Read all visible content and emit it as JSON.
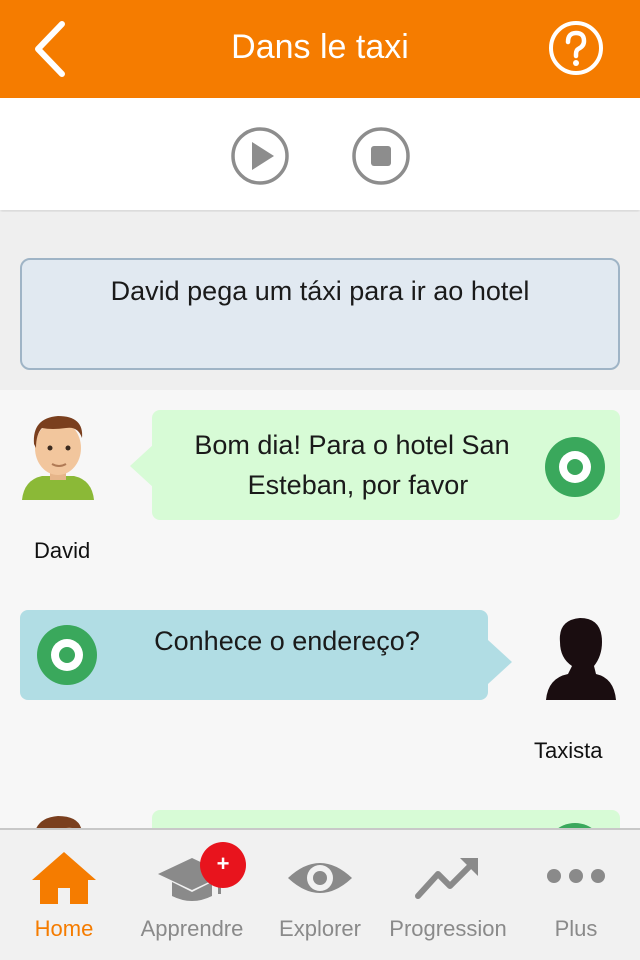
{
  "header": {
    "title": "Dans le taxi",
    "back_icon": "chevron-left-icon",
    "help_icon": "help-circle-icon"
  },
  "controls": {
    "play_icon": "play-icon",
    "stop_icon": "stop-icon"
  },
  "intro": {
    "text": "David pega um táxi para ir ao hotel"
  },
  "dialogue": [
    {
      "speaker": "David",
      "text_line1": "Bom dia! Para o hotel San",
      "text_line2": "Esteban, por favor",
      "audio_icon": "audio-play-icon"
    },
    {
      "speaker": "Taxista",
      "text_line1": "Conhece o endereço?",
      "audio_icon": "audio-play-icon"
    }
  ],
  "tabbar": {
    "tabs": [
      {
        "label": "Home",
        "icon": "home-icon",
        "active": true
      },
      {
        "label": "Apprendre",
        "icon": "graduation-cap-icon",
        "badge": "+"
      },
      {
        "label": "Explorer",
        "icon": "eye-icon"
      },
      {
        "label": "Progression",
        "icon": "trending-up-icon"
      },
      {
        "label": "Plus",
        "icon": "more-dots-icon"
      }
    ]
  },
  "colors": {
    "accent": "#f57c00",
    "bubble_green": "#d7fbd6",
    "bubble_blue": "#b1dde4",
    "audio_green": "#3aa85c",
    "badge_red": "#e8141d",
    "inactive_icon": "#8a8a8a"
  }
}
